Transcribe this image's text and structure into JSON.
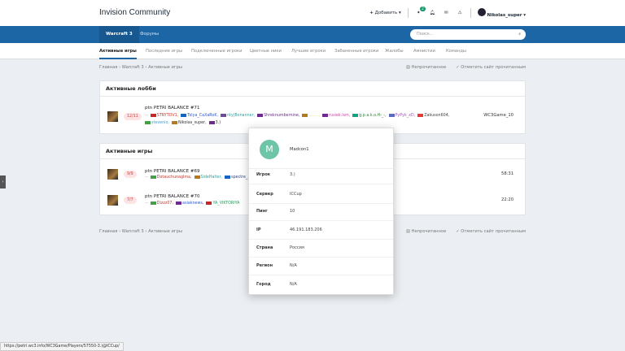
{
  "header": {
    "title": "Invision Community",
    "add_label": "Добавить",
    "notif_count": "2",
    "username": "Nikolas_super"
  },
  "nav": {
    "tabs": [
      "Warcraft 3",
      "Форумы"
    ],
    "search_placeholder": "Поиск..."
  },
  "subnav": [
    "Активные игры",
    "Последние игры",
    "Подключенные игроки",
    "Цветные ники",
    "Лучшие игроки",
    "Забаненные игроки",
    "Жалобы",
    "Амнистии",
    "Команды"
  ],
  "breadcrumb": {
    "home": "Главная",
    "section": "Warcraft 3",
    "page": "Активные игры",
    "unread": "Непрочитанное",
    "mark_read": "Отметить сайт прочитанным"
  },
  "lobbies": {
    "title": "Активные лобби",
    "items": [
      {
        "slots": "12/11",
        "name": "ptn PETRI BALANCE #71",
        "right": "WC3Game_10",
        "players": [
          {
            "name": "STRYTOV1",
            "color": "#c0392b",
            "flag": "#c62828"
          },
          {
            "name": "Tolya_CaXaRoK",
            "color": "#2c5bd6",
            "flag": "#1565c0"
          },
          {
            "name": "nty|Bonanner",
            "color": "#27a5a0",
            "flag": "#6d4c9b"
          },
          {
            "name": "Shreknumbernine",
            "color": "#6d2a8f",
            "flag": "#6d2a8f"
          },
          {
            "name": "........",
            "color": "#e6d21a",
            "flag": "#b57a1f"
          },
          {
            "name": "rusiek.lsm",
            "color": "#c2499f",
            "flag": "#6d2a8f"
          },
          {
            "name": "g.p.a.k.o.H-_-",
            "color": "#2e7d32",
            "flag": "#16a085"
          },
          {
            "name": "PyPyk_xD",
            "color": "#ad4fc9",
            "flag": "#5c6bc0"
          },
          {
            "name": "Zakuson604",
            "color": "#444",
            "flag": "#e53935"
          },
          {
            "name": "stevenio",
            "color": "#3aa0d8",
            "flag": "#43a047"
          },
          {
            "name": "Nikolas_super",
            "color": "#333",
            "flag": "#b57a1f"
          },
          {
            "name": "3.)",
            "color": "#333",
            "flag": "#6d2a8f"
          }
        ]
      }
    ]
  },
  "games": {
    "title": "Активные игры",
    "items": [
      {
        "slots": "9/9",
        "name": "ptn PETRI BALANCE #69",
        "right": "58:31",
        "players": [
          {
            "name": "Dotauchunaglma",
            "color": "#c0392b",
            "flag": "#43a047"
          },
          {
            "name": "SideHalter",
            "color": "#27a5a0",
            "flag": "#b57a1f"
          },
          {
            "name": "spectre_",
            "color": "#2c3e8f",
            "flag": "#1565c0"
          },
          {
            "name": "ImmOfNo_Payel",
            "color": "#6a9bd1",
            "flag": "#8d6e63"
          },
          {
            "name": "re011y",
            "color": "#333",
            "flag": "#43a047"
          }
        ]
      },
      {
        "slots": "7/7",
        "name": "ptn PETRI BALANCE #70",
        "right": "22:20",
        "players": [
          {
            "name": "Dizzz07",
            "color": "#c0392b",
            "flag": "#43a047"
          },
          {
            "name": "asiaknews",
            "color": "#2c5bd6",
            "flag": "#6d2a8f"
          },
          {
            "name": "YA_VIKTORIYA",
            "color": "#1e9e5a",
            "flag": "#c62828"
          }
        ]
      }
    ]
  },
  "popup": {
    "avatar": "M",
    "name": "Madcon1",
    "rows": [
      {
        "label": "Игрок",
        "value": "3.)"
      },
      {
        "label": "Сервер",
        "value": "ICCup"
      },
      {
        "label": "Пинг",
        "value": "10"
      },
      {
        "label": "IP",
        "value": "46.191.183.206"
      },
      {
        "label": "Страна",
        "value": "Россия"
      },
      {
        "label": "Регион",
        "value": "N/A"
      },
      {
        "label": "Город",
        "value": "N/A"
      }
    ]
  },
  "status_url": "https://petri.wc3.info/WC3Game/Players/57550-3.)@ICCup/"
}
